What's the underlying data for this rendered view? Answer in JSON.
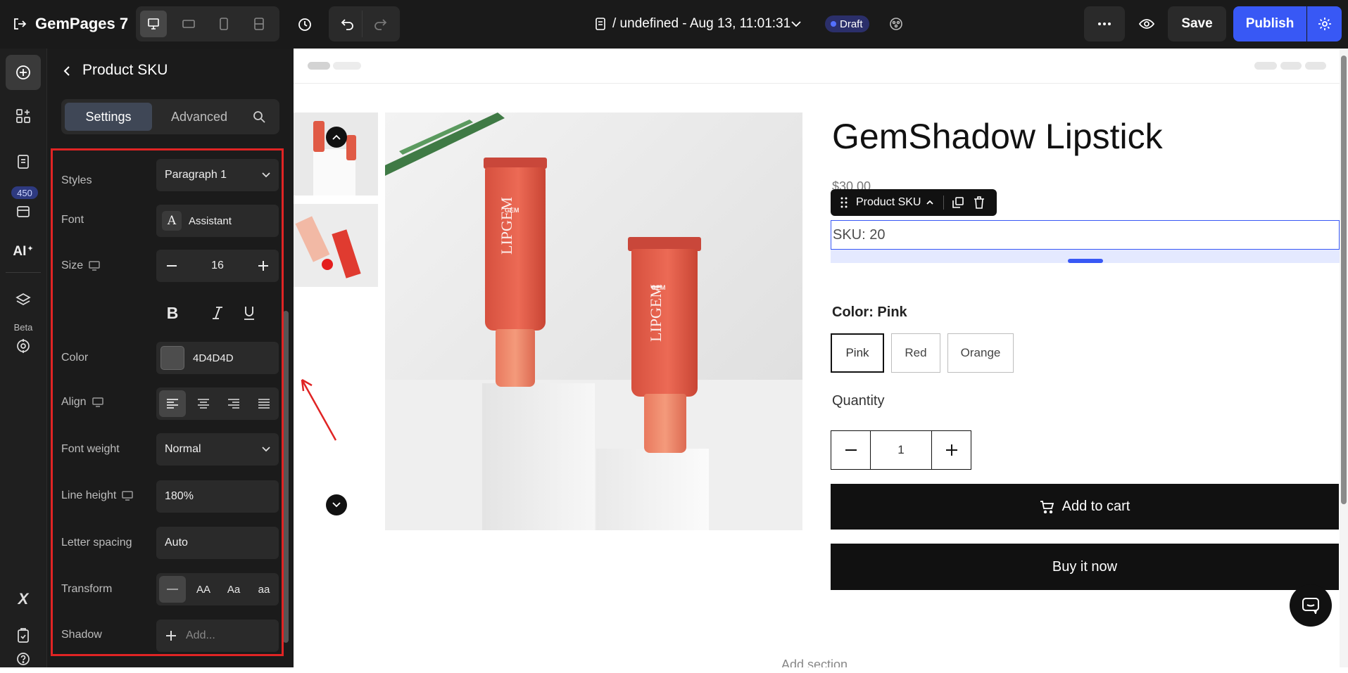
{
  "app": {
    "name": "GemPages 7",
    "title": "/ undefined - Aug 13, 11:01:31",
    "status_badge": "Draft"
  },
  "toolbar": {
    "save_label": "Save",
    "publish_label": "Publish"
  },
  "rail": {
    "badge_count": "450",
    "beta_label": "Beta"
  },
  "panel": {
    "title": "Product SKU",
    "tabs": [
      "Settings",
      "Advanced"
    ],
    "styles_label": "Styles",
    "styles_value": "Paragraph 1",
    "font_label": "Font",
    "font_icon_glyph": "A",
    "font_value": "Assistant",
    "size_label": "Size",
    "size_value": "16",
    "format_glyphs": {
      "bold": "B",
      "italic": "I",
      "underline": "U"
    },
    "color_label": "Color",
    "color_value": "4D4D4D",
    "color_swatch": "#4D4D4D",
    "align_label": "Align",
    "font_weight_label": "Font weight",
    "font_weight_value": "Normal",
    "line_height_label": "Line height",
    "line_height_value": "180%",
    "letter_spacing_label": "Letter spacing",
    "letter_spacing_value": "Auto",
    "transform_label": "Transform",
    "transform_options": [
      "—",
      "AA",
      "Aa",
      "aa"
    ],
    "shadow_label": "Shadow",
    "shadow_placeholder": "Add..."
  },
  "product": {
    "title": "GemShadow Lipstick",
    "price_partial": "$30.00",
    "sku_tag": "Product SKU",
    "sku_text": "SKU: 20",
    "color_label": "Color: Pink",
    "variants": [
      "Pink",
      "Red",
      "Orange"
    ],
    "quantity_label": "Quantity",
    "quantity_value": "1",
    "add_to_cart": "Add to cart",
    "buy_now": "Buy it now",
    "add_section": "Add section",
    "tube_brand": "LIPGEM",
    "tube_logo": "GEM"
  },
  "colors": {
    "accent": "#3858f5",
    "highlight_red": "#e02424",
    "topbar_bg": "#1a1a1a",
    "panel_bg": "#1b1b1b",
    "dark_button": "#111111"
  }
}
